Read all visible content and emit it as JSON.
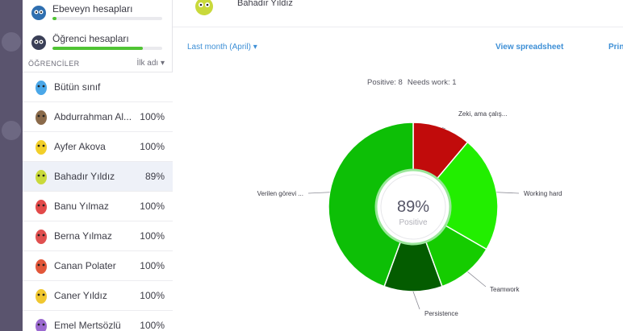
{
  "sidebar": {
    "accounts": [
      {
        "label": "Ebeveyn hesapları",
        "progress": 0.04
      },
      {
        "label": "Öğrenci hesapları",
        "progress": 0.82
      }
    ],
    "section_title": "ÖĞRENCİLER",
    "sort_label": "İlk adı ▾",
    "rows": [
      {
        "name": "Bütün sınıf",
        "percent": "",
        "icon_color": "#4aa7e8"
      },
      {
        "name": "Abdurrahman Al...",
        "percent": "100%",
        "icon_color": "#8a6a4a"
      },
      {
        "name": "Ayfer Akova",
        "percent": "100%",
        "icon_color": "#f2cf2a"
      },
      {
        "name": "Bahadır Yıldız",
        "percent": "89%",
        "icon_color": "#c9d93b"
      },
      {
        "name": "Banu Yılmaz",
        "percent": "100%",
        "icon_color": "#e24a4a"
      },
      {
        "name": "Berna Yılmaz",
        "percent": "100%",
        "icon_color": "#e05050"
      },
      {
        "name": "Canan Polater",
        "percent": "100%",
        "icon_color": "#e2573a"
      },
      {
        "name": "Caner Yıldız",
        "percent": "100%",
        "icon_color": "#f0c730"
      },
      {
        "name": "Emel Mertsözlü",
        "percent": "100%",
        "icon_color": "#9b6ad0"
      }
    ]
  },
  "header": {
    "student_name": "Bahadır Yıldız"
  },
  "toolbar": {
    "filter_label": "Last month (April) ▾",
    "view_spreadsheet": "View spreadsheet",
    "print_label": "Prin"
  },
  "summary": {
    "positive": "Positive: 8",
    "needs_work": "Needs work: 1"
  },
  "chart_data": {
    "type": "donut",
    "center_value": "89%",
    "center_label": "Positive",
    "slices": [
      {
        "label": "Zeki, ama çalış...",
        "value": 1,
        "color": "#c10b0b"
      },
      {
        "label": "Working hard",
        "value": 2,
        "color": "#22ee00"
      },
      {
        "label": "Teamwork",
        "value": 1,
        "color": "#15cc00"
      },
      {
        "label": "Persistence",
        "value": 1,
        "color": "#045c00"
      },
      {
        "label": "Verilen görevi ...",
        "value": 4,
        "color": "#0dbf06"
      }
    ]
  }
}
